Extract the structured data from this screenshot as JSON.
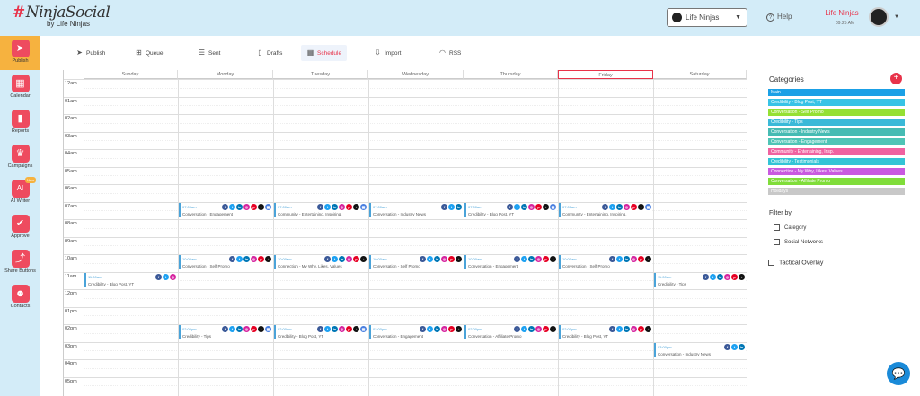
{
  "header": {
    "logo_text": "NinjaSocial",
    "logo_hash": "#",
    "logo_sub": "by Life Ninjas",
    "account_select": "Life Ninjas",
    "help": "Help",
    "user_name": "Life Ninjas",
    "user_time": "09:25 AM"
  },
  "sidebar": {
    "items": [
      {
        "label": "Publish",
        "icon": "paper-plane-icon",
        "glyph": "➤"
      },
      {
        "label": "Calendar",
        "icon": "calendar-icon",
        "glyph": "▦"
      },
      {
        "label": "Reports",
        "icon": "bar-chart-icon",
        "glyph": "▮"
      },
      {
        "label": "Campaigns",
        "icon": "trophy-icon",
        "glyph": "♛"
      },
      {
        "label": "AI Writer",
        "icon": "ai-writer-icon",
        "glyph": "AI",
        "badge": "New"
      },
      {
        "label": "Approve",
        "icon": "approve-icon",
        "glyph": "✔"
      },
      {
        "label": "Share Buttons",
        "icon": "share-icon",
        "glyph": "⤴"
      },
      {
        "label": "Contacts",
        "icon": "contacts-icon",
        "glyph": "☻"
      }
    ]
  },
  "tabs": [
    {
      "label": "Publish",
      "icon": "send-icon",
      "glyph": "➤"
    },
    {
      "label": "Queue",
      "icon": "queue-icon",
      "glyph": "⊞"
    },
    {
      "label": "Sent",
      "icon": "list-icon",
      "glyph": "☰"
    },
    {
      "label": "Drafts",
      "icon": "draft-icon",
      "glyph": "▯"
    },
    {
      "label": "Schedule",
      "icon": "schedule-icon",
      "glyph": "▦"
    },
    {
      "label": "Import",
      "icon": "import-icon",
      "glyph": "⇩"
    },
    {
      "label": "RSS",
      "icon": "rss-icon",
      "glyph": "◠"
    }
  ],
  "calendar": {
    "days": [
      "Sunday",
      "Monday",
      "Tuesday",
      "Wednesday",
      "Thursday",
      "Friday",
      "Saturday"
    ],
    "today_index": 5,
    "hours": [
      "12am",
      "01am",
      "02am",
      "03am",
      "04am",
      "05am",
      "06am",
      "07am",
      "08am",
      "09am",
      "10am",
      "11am",
      "12pm",
      "01pm",
      "02pm",
      "03pm",
      "04pm",
      "05pm"
    ],
    "events": [
      {
        "day": 1,
        "slot": 7,
        "time": "07:00am",
        "name": "Conversation - Engagement",
        "icons": [
          "fb",
          "tw",
          "li",
          "ig",
          "pi",
          "tt",
          "gb"
        ]
      },
      {
        "day": 2,
        "slot": 7,
        "time": "07:00am",
        "name": "Community - Entertaining, Inspiring,",
        "icons": [
          "fb",
          "tw",
          "li",
          "ig",
          "pi",
          "tt",
          "gb"
        ]
      },
      {
        "day": 3,
        "slot": 7,
        "time": "07:00am",
        "name": "Conversation - Industry News",
        "icons": [
          "fb",
          "tw",
          "li"
        ]
      },
      {
        "day": 4,
        "slot": 7,
        "time": "07:00am",
        "name": "Credibility - Blog Post, YT",
        "icons": [
          "fb",
          "tw",
          "li",
          "ig",
          "pi",
          "tt",
          "gb"
        ]
      },
      {
        "day": 5,
        "slot": 7,
        "time": "07:00am",
        "name": "Community - Entertaining, Inspiring,",
        "icons": [
          "fb",
          "tw",
          "li",
          "ig",
          "pi",
          "tt",
          "gb"
        ]
      },
      {
        "day": 1,
        "slot": 10,
        "time": "10:00am",
        "name": "Conversation - Self Promo",
        "icons": [
          "fb",
          "tw",
          "li",
          "ig",
          "pi",
          "tt"
        ]
      },
      {
        "day": 2,
        "slot": 10,
        "time": "10:00am",
        "name": "Connection - My Why, Likes, Values",
        "icons": [
          "fb",
          "tw",
          "li",
          "ig",
          "pi",
          "tt"
        ]
      },
      {
        "day": 3,
        "slot": 10,
        "time": "10:00am",
        "name": "Conversation - Self Promo",
        "icons": [
          "fb",
          "tw",
          "li",
          "ig",
          "pi",
          "tt"
        ]
      },
      {
        "day": 4,
        "slot": 10,
        "time": "10:00am",
        "name": "Conversation - Engagement",
        "icons": [
          "fb",
          "tw",
          "li",
          "ig",
          "pi",
          "tt"
        ]
      },
      {
        "day": 5,
        "slot": 10,
        "time": "10:00am",
        "name": "Conversation - Self Promo",
        "icons": [
          "fb",
          "tw",
          "li",
          "ig",
          "pi",
          "tt"
        ]
      },
      {
        "day": 0,
        "slot": 11,
        "time": "11:00am",
        "name": "Credibility - Blog Post, YT",
        "icons": [
          "fb",
          "tw",
          "ig"
        ]
      },
      {
        "day": 6,
        "slot": 11,
        "time": "11:00am",
        "name": "Credibility - Tips",
        "icons": [
          "fb",
          "tw",
          "li",
          "ig",
          "pi",
          "tt"
        ]
      },
      {
        "day": 1,
        "slot": 14,
        "time": "02:00pm",
        "name": "Credibility - Tips",
        "icons": [
          "fb",
          "tw",
          "li",
          "ig",
          "pi",
          "tt",
          "gb"
        ]
      },
      {
        "day": 2,
        "slot": 14,
        "time": "02:00pm",
        "name": "Credibility - Blog Post, YT",
        "icons": [
          "fb",
          "tw",
          "li",
          "ig",
          "pi",
          "tt",
          "gb"
        ]
      },
      {
        "day": 3,
        "slot": 14,
        "time": "02:00pm",
        "name": "Conversation - Engagement",
        "icons": [
          "fb",
          "tw",
          "li",
          "ig",
          "pi",
          "tt"
        ]
      },
      {
        "day": 4,
        "slot": 14,
        "time": "02:00pm",
        "name": "Conversation - Affiliate Promo",
        "icons": [
          "fb",
          "tw",
          "li",
          "ig",
          "pi",
          "tt"
        ]
      },
      {
        "day": 5,
        "slot": 14,
        "time": "02:00pm",
        "name": "Credibility - Blog Post, YT",
        "icons": [
          "fb",
          "tw",
          "li",
          "ig",
          "pi",
          "tt"
        ]
      },
      {
        "day": 6,
        "slot": 15,
        "time": "03:00pm",
        "name": "Conversation - Industry News",
        "icons": [
          "fb",
          "tw",
          "li"
        ]
      }
    ]
  },
  "social_icons": {
    "fb": {
      "color": "#3b5998",
      "glyph": "f"
    },
    "tw": {
      "color": "#1da1f2",
      "glyph": "t"
    },
    "li": {
      "color": "#0077b5",
      "glyph": "in"
    },
    "ig": {
      "color": "#d6249f",
      "glyph": "◎"
    },
    "pi": {
      "color": "#e60023",
      "glyph": "p"
    },
    "tt": {
      "color": "#111111",
      "glyph": "♪"
    },
    "gb": {
      "color": "#4a7fe0",
      "glyph": "▦"
    }
  },
  "categories": {
    "title": "Categories",
    "add": "+",
    "items": [
      {
        "label": "Main",
        "color": "#1aa0e6"
      },
      {
        "label": "Credibility - Blog Post, YT",
        "color": "#37c3e6"
      },
      {
        "label": "Conversation - Self Promo",
        "color": "#95e033"
      },
      {
        "label": "Credibility - Tips",
        "color": "#3ab9d8"
      },
      {
        "label": "Conversation - Industry News",
        "color": "#46bbb3"
      },
      {
        "label": "Conversation - Engagement",
        "color": "#4fc4b6"
      },
      {
        "label": "Community - Entertaining, Insp.",
        "color": "#f062a0"
      },
      {
        "label": "Credibility - Testimonials",
        "color": "#33c4d6"
      },
      {
        "label": "Connection - My Why, Likes, Values",
        "color": "#c95ae0"
      },
      {
        "label": "Conversation - Affiliate Promo",
        "color": "#80dd3a"
      },
      {
        "label": "Holidays",
        "color": "#c8c8c8"
      }
    ]
  },
  "filter": {
    "title": "Filter by",
    "options": [
      "Category",
      "Social Networks"
    ],
    "overlay": "Tactical Overlay"
  }
}
